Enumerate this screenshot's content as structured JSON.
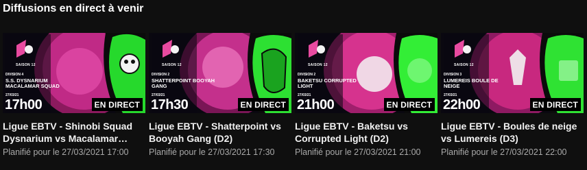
{
  "section": {
    "title": "Diffusions en direct à venir"
  },
  "theme": {
    "magenta": "#d12a8c",
    "green": "#2ee832",
    "live_badge_bg": "#000000"
  },
  "cards": [
    {
      "thumbnail": {
        "season": "SAISON 12",
        "division": "DIVISION 4",
        "teams": "S.S. DYSNARIUM MACALAMAR SQUAD",
        "date": "27/03/21",
        "time": "17h00"
      },
      "live_badge": "EN DIRECT",
      "title": "Ligue EBTV - Shinobi Squad Dysnarium vs Macalamar…",
      "scheduled": "Planifié pour le 27/03/2021 17:00"
    },
    {
      "thumbnail": {
        "season": "SAISON 12",
        "division": "DIVISION 2",
        "teams": "SHATTERPOINT BOOYAH GANG",
        "date": "27/03/21",
        "time": "17h30"
      },
      "live_badge": "EN DIRECT",
      "title": "Ligue EBTV - Shatterpoint vs Booyah Gang (D2)",
      "scheduled": "Planifié pour le 27/03/2021 17:30"
    },
    {
      "thumbnail": {
        "season": "SAISON 12",
        "division": "DIVISION 2",
        "teams": "BAKETSU CORRUPTED LIGHT",
        "date": "27/03/21",
        "time": "21h00"
      },
      "live_badge": "EN DIRECT",
      "title": "Ligue EBTV - Baketsu vs Corrupted Light (D2)",
      "scheduled": "Planifié pour le 27/03/2021 21:00"
    },
    {
      "thumbnail": {
        "season": "SAISON 12",
        "division": "DIVISION 3",
        "teams": "LUMEREIS BOULE DE NEIGE",
        "date": "27/03/21",
        "time": "22h00"
      },
      "live_badge": "EN DIRECT",
      "title": "Ligue EBTV - Boules de neige vs Lumereis (D3)",
      "scheduled": "Planifié pour le 27/03/2021 22:00"
    }
  ]
}
